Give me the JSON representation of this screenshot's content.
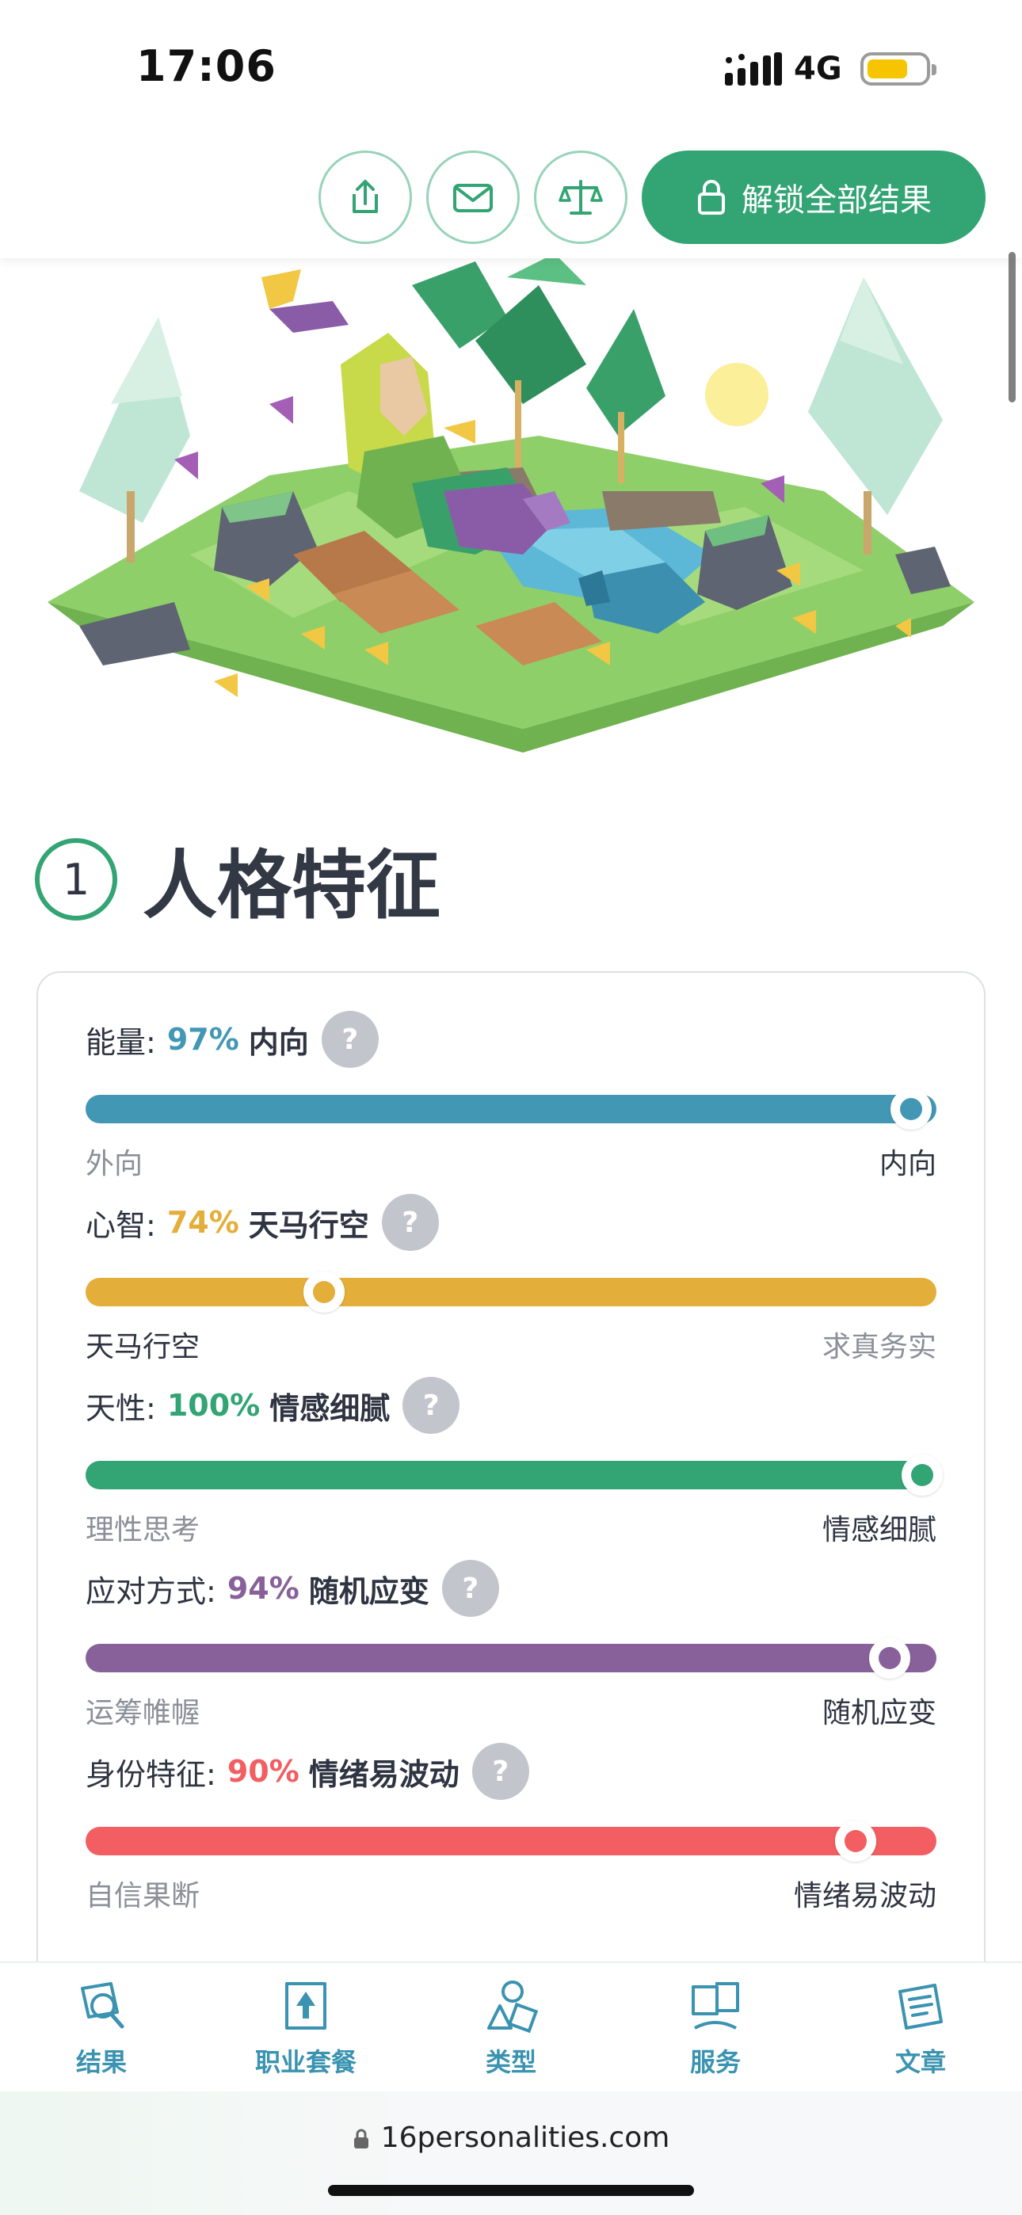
{
  "status_bar": {
    "time": "17:06",
    "network": "4G"
  },
  "toolbar": {
    "share_icon": "share-icon",
    "mail_icon": "mail-icon",
    "compare_icon": "scale-icon",
    "unlock_label": "解锁全部结果"
  },
  "section": {
    "number": "1",
    "title": "人格特征"
  },
  "traits": [
    {
      "label": "能量:",
      "percent": "97%",
      "name": "内向",
      "left_pole": "外向",
      "right_pole": "内向",
      "color": "#4298b4",
      "knob_position": 0.97,
      "active_side": "right"
    },
    {
      "label": "心智:",
      "percent": "74%",
      "name": "天马行空",
      "left_pole": "天马行空",
      "right_pole": "求真务实",
      "color": "#e4ae3a",
      "knob_position": 0.28,
      "active_side": "left"
    },
    {
      "label": "天性:",
      "percent": "100%",
      "name": "情感细腻",
      "left_pole": "理性思考",
      "right_pole": "情感细腻",
      "color": "#33a474",
      "knob_position": 1.0,
      "active_side": "right"
    },
    {
      "label": "应对方式:",
      "percent": "94%",
      "name": "随机应变",
      "left_pole": "运筹帷幄",
      "right_pole": "随机应变",
      "color": "#88619a",
      "knob_position": 0.945,
      "active_side": "right"
    },
    {
      "label": "身份特征:",
      "percent": "90%",
      "name": "情绪易波动",
      "left_pole": "自信果断",
      "right_pole": "情绪易波动",
      "color": "#f25e62",
      "knob_position": 0.905,
      "active_side": "right"
    }
  ],
  "tabs": [
    {
      "label": "结果",
      "icon": "search-results-icon"
    },
    {
      "label": "职业套餐",
      "icon": "career-icon"
    },
    {
      "label": "类型",
      "icon": "types-icon"
    },
    {
      "label": "服务",
      "icon": "services-icon"
    },
    {
      "label": "文章",
      "icon": "articles-icon"
    }
  ],
  "browser": {
    "url": "16personalities.com"
  },
  "colors": {
    "accent": "#33a474",
    "tab_blue": "#3a93b0"
  }
}
